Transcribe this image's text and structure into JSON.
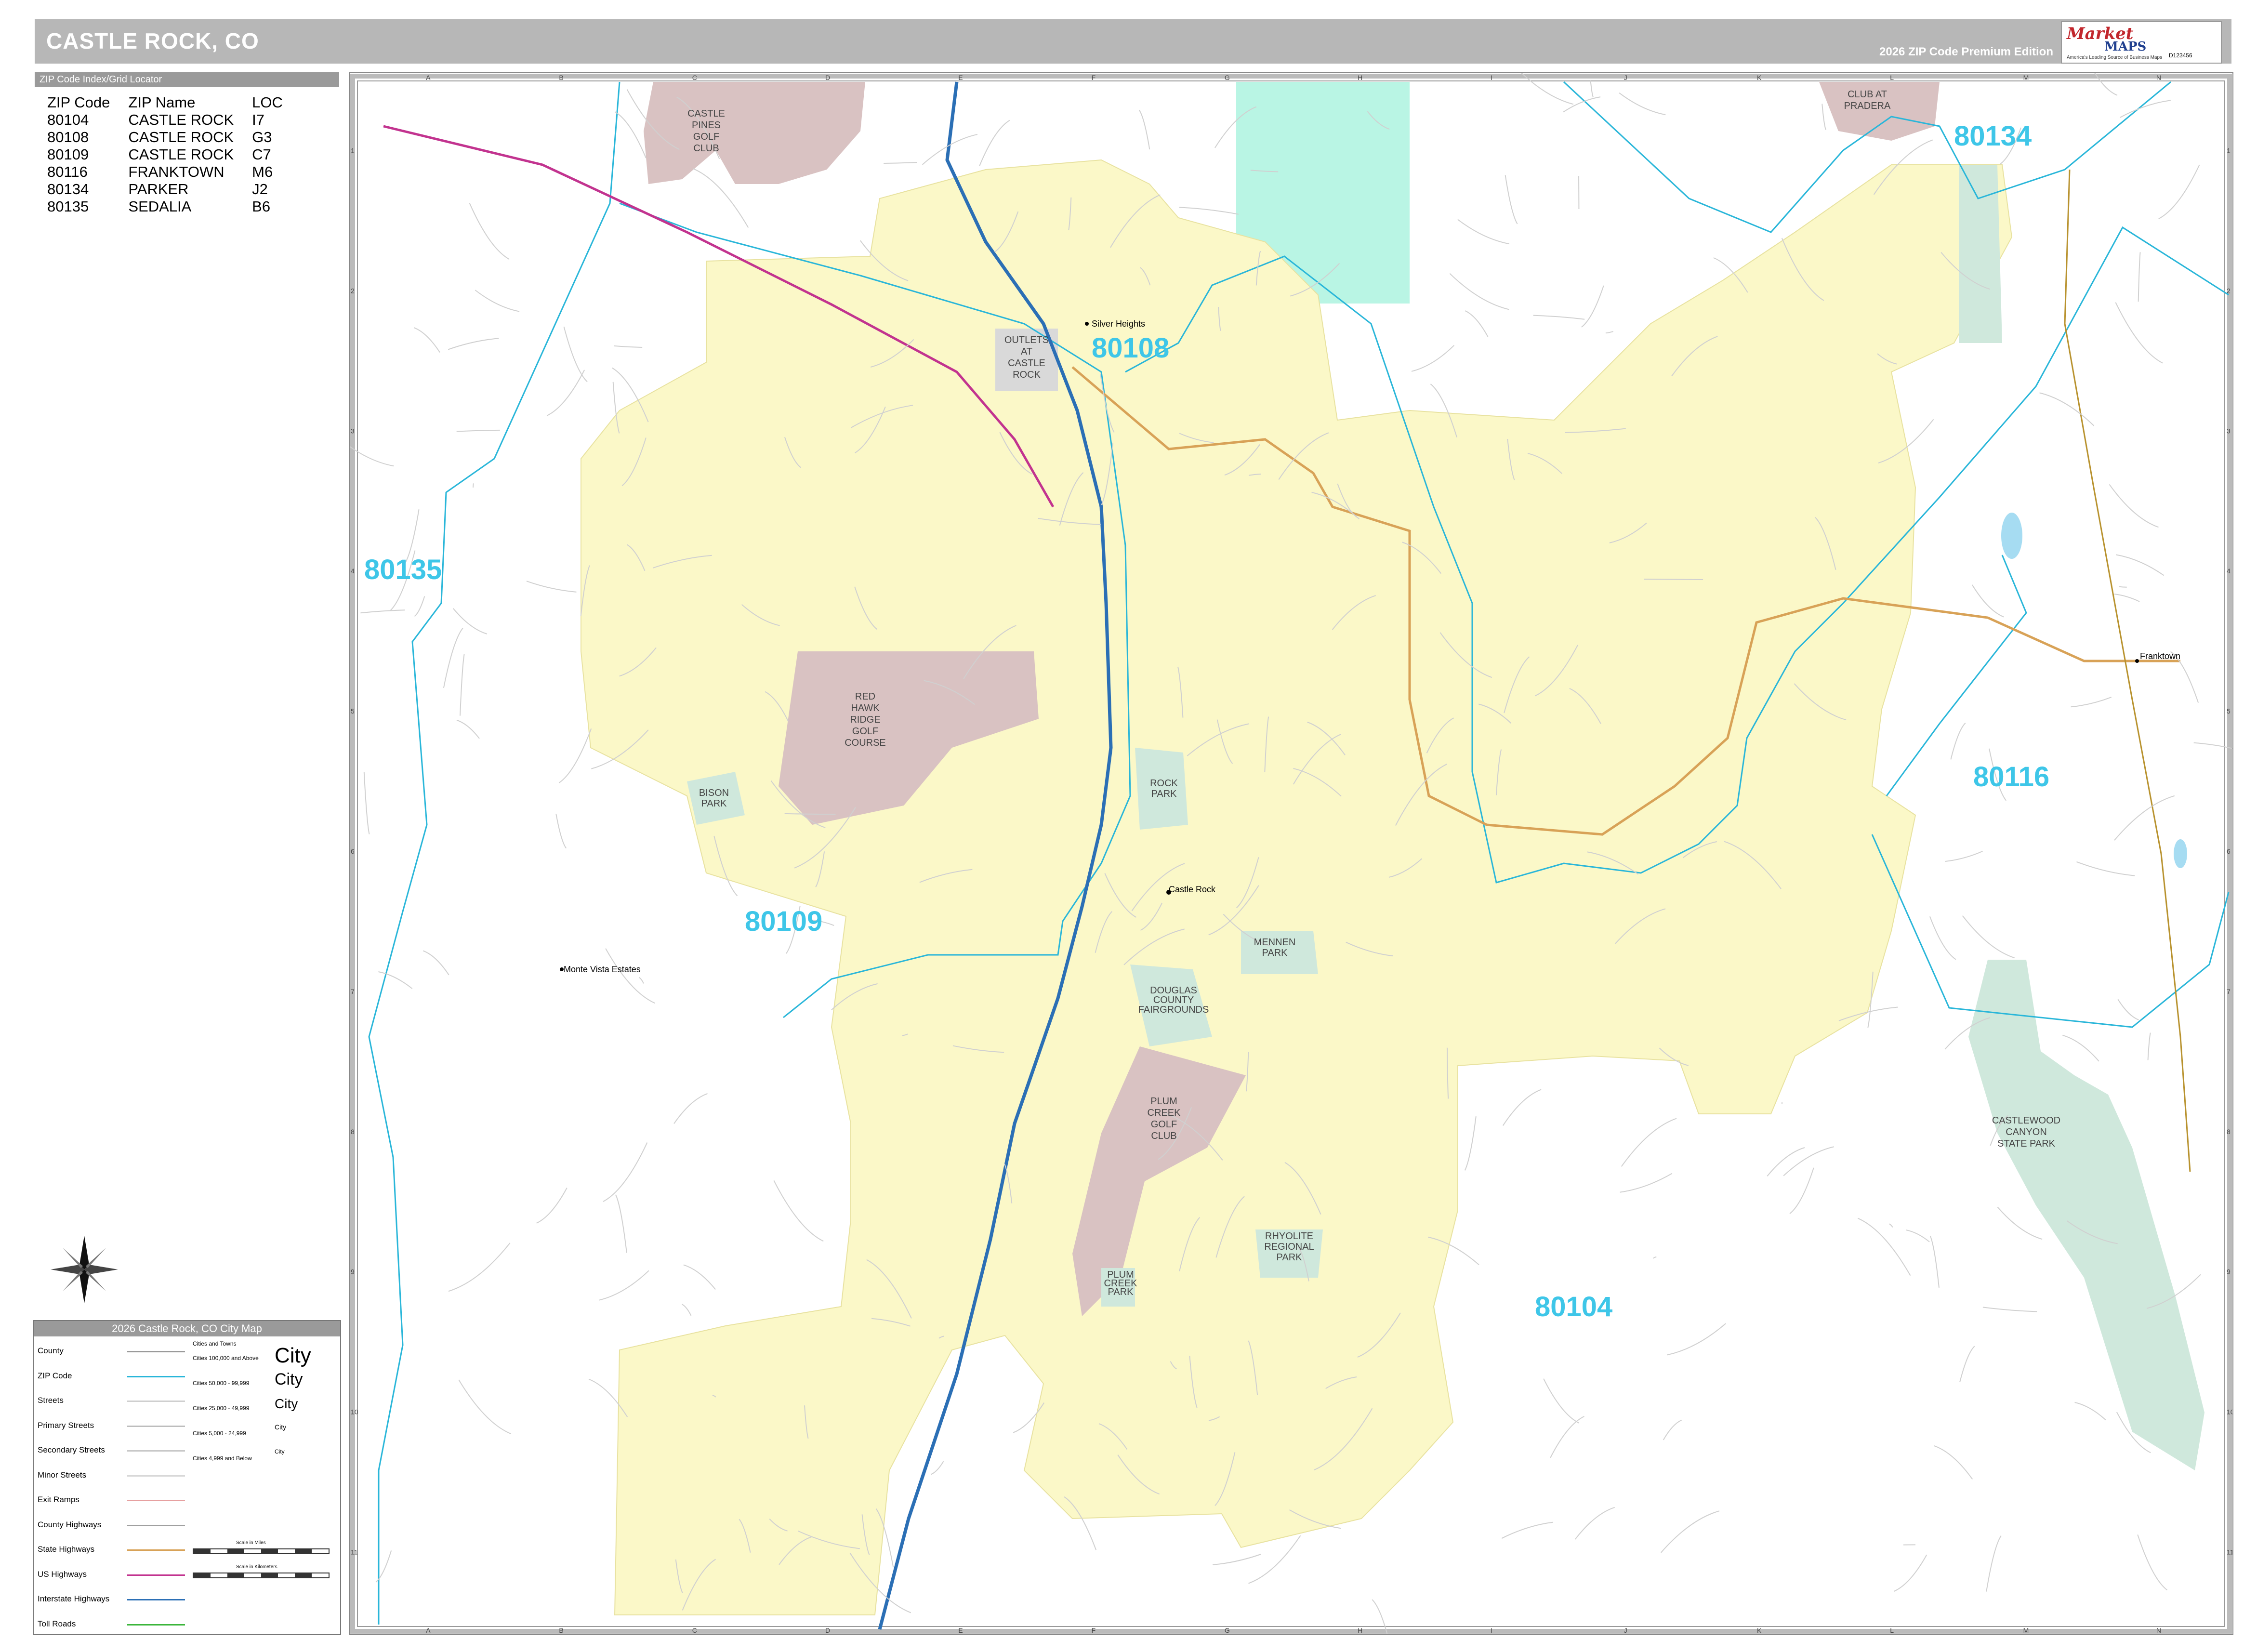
{
  "header": {
    "title": "CASTLE ROCK, CO",
    "edition": "2026 ZIP Code Premium Edition"
  },
  "logo": {
    "brand_top": "Market",
    "brand_bottom": "MAPS",
    "tagline": "America's Leading Source of Business Maps",
    "code": "D123456"
  },
  "locator": {
    "heading": "ZIP Code Index/Grid Locator",
    "columns": [
      "ZIP Code",
      "ZIP Name",
      "LOC"
    ],
    "rows": [
      [
        "80104",
        "CASTLE ROCK",
        "I7"
      ],
      [
        "80108",
        "CASTLE ROCK",
        "G3"
      ],
      [
        "80109",
        "CASTLE ROCK",
        "C7"
      ],
      [
        "80116",
        "FRANKTOWN",
        "M6"
      ],
      [
        "80134",
        "PARKER",
        "J2"
      ],
      [
        "80135",
        "SEDALIA",
        "B6"
      ]
    ]
  },
  "legend": {
    "heading": "2026 Castle Rock, CO City Map",
    "items": [
      {
        "label": "County",
        "color": "#9a9a9a"
      },
      {
        "label": "ZIP Code",
        "color": "#29b6d9"
      },
      {
        "label": "Streets",
        "color": "#cfcfcf"
      },
      {
        "label": "Primary Streets",
        "color": "#bdbdbd"
      },
      {
        "label": "Secondary Streets",
        "color": "#c8c8c8"
      },
      {
        "label": "Minor Streets",
        "color": "#d8d8d8"
      },
      {
        "label": "Exit Ramps",
        "color": "#e6a0a0"
      },
      {
        "label": "County Highways",
        "color": "#a0a0a0"
      },
      {
        "label": "State Highways",
        "color": "#d8a257"
      },
      {
        "label": "US Highways",
        "color": "#c2338f"
      },
      {
        "label": "Interstate Highways",
        "color": "#2b6fb5"
      },
      {
        "label": "Toll Roads",
        "color": "#3bb53b"
      }
    ],
    "cities_heading": "Cities and Towns",
    "cities": [
      {
        "range": "Cities 100,000 and Above",
        "sample": "City"
      },
      {
        "range": "Cities 50,000 - 99,999",
        "sample": "City"
      },
      {
        "range": "Cities 25,000 - 49,999",
        "sample": "City"
      },
      {
        "range": "Cities 5,000 - 24,999",
        "sample": "City"
      },
      {
        "range": "Cities 4,999 and Below",
        "sample": "City"
      }
    ],
    "scale_miles": "Scale in Miles",
    "scale_km": "Scale in Kilometers"
  },
  "map": {
    "columns": [
      "A",
      "B",
      "C",
      "D",
      "E",
      "F",
      "G",
      "H",
      "I",
      "J",
      "K",
      "L",
      "M",
      "N"
    ],
    "rows": [
      "1",
      "2",
      "3",
      "4",
      "5",
      "6",
      "7",
      "8",
      "9",
      "10",
      "11"
    ],
    "zip_labels": [
      "80134",
      "80108",
      "80135",
      "80116",
      "80109",
      "80104"
    ],
    "places": [
      "Silver Heights",
      "Castle Rock",
      "Monte Vista Estates",
      "Franktown"
    ],
    "features": {
      "castle_pines": [
        "CASTLE",
        "PINES",
        "GOLF",
        "CLUB"
      ],
      "club_pradera": [
        "CLUB AT",
        "PRADERA"
      ],
      "outlets": [
        "OUTLETS",
        "AT",
        "CASTLE",
        "ROCK"
      ],
      "red_hawk": [
        "RED",
        "HAWK",
        "RIDGE",
        "GOLF",
        "COURSE"
      ],
      "bison_park": [
        "BISON",
        "PARK"
      ],
      "rock_park": [
        "ROCK",
        "PARK"
      ],
      "mennen_park": [
        "MENNEN",
        "PARK"
      ],
      "fairgrounds": [
        "DOUGLAS",
        "COUNTY",
        "FAIRGROUNDS"
      ],
      "plum_creek": [
        "PLUM",
        "CREEK",
        "GOLF",
        "CLUB"
      ],
      "plum_creek_park": [
        "PLUM",
        "CREEK",
        "PARK"
      ],
      "rhyolite": [
        "RHYOLITE",
        "REGIONAL",
        "PARK"
      ],
      "castlewood": [
        "CASTLEWOOD",
        "CANYON",
        "STATE PARK"
      ]
    },
    "colors": {
      "city_fill": "#fbf8c8",
      "park_fill": "#cfe8dc",
      "golf_fill": "#d9c2c2",
      "state_land": "#b9f5e4",
      "zip_line": "#29b6d9",
      "interstate": "#2b6fb5",
      "state_hwy": "#d8a257",
      "us_hwy": "#c2338f",
      "water": "#a6dcf2"
    }
  }
}
